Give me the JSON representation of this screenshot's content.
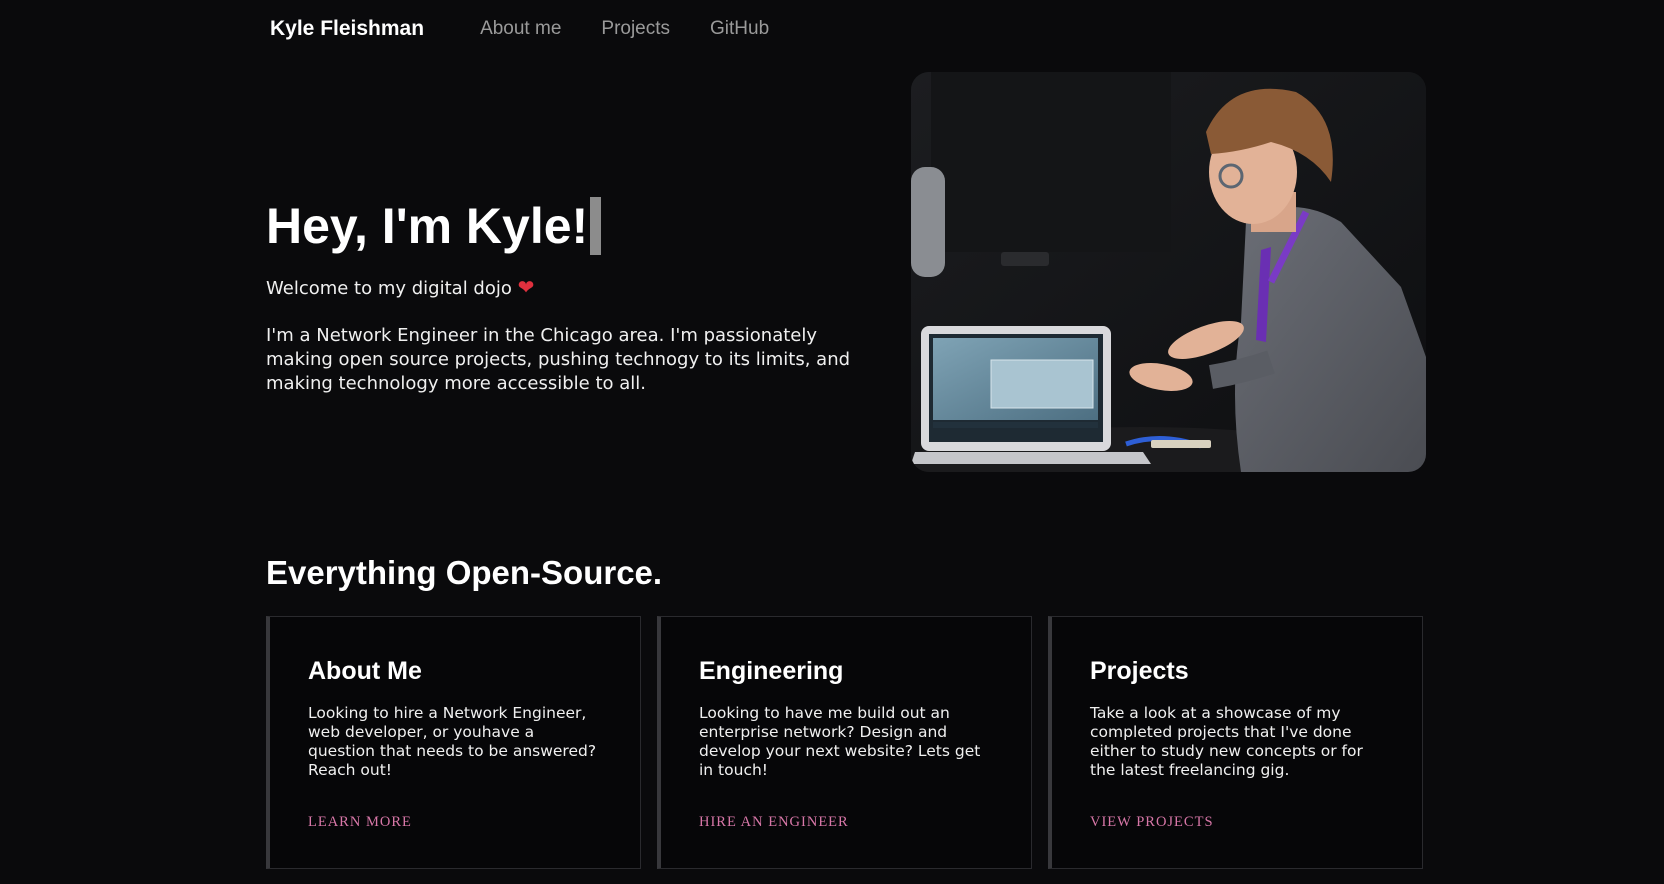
{
  "nav": {
    "brand": "Kyle Fleishman",
    "links": [
      "About me",
      "Projects",
      "GitHub"
    ]
  },
  "hero": {
    "title": "Hey, I'm Kyle!",
    "welcome": "Welcome to my digital dojo",
    "heart_icon": "heart-icon",
    "body": "I'm a Network Engineer in the Chicago area. I'm passionately making open source projects, pushing technogy to its limits, and making technology more accessible to all."
  },
  "section": {
    "title": "Everything Open-Source."
  },
  "cards": [
    {
      "title": "About Me",
      "text": "Looking to hire a Network Engineer, web developer, or youhave a question that needs to be answered? Reach out!",
      "link": "LEARN MORE"
    },
    {
      "title": "Engineering",
      "text": "Looking to have me build out an enterprise network? Design and develop your next website? Lets get in touch!",
      "link": "HIRE AN ENGINEER"
    },
    {
      "title": "Projects",
      "text": "Take a look at a showcase of my completed projects that I've done either to study new concepts or for the latest freelancing gig.",
      "link": "VIEW PROJECTS"
    }
  ],
  "colors": {
    "background": "#0a0a0c",
    "accent_link": "#d877a8",
    "heart": "#e0303e",
    "nav_link": "#9a9a9a"
  }
}
